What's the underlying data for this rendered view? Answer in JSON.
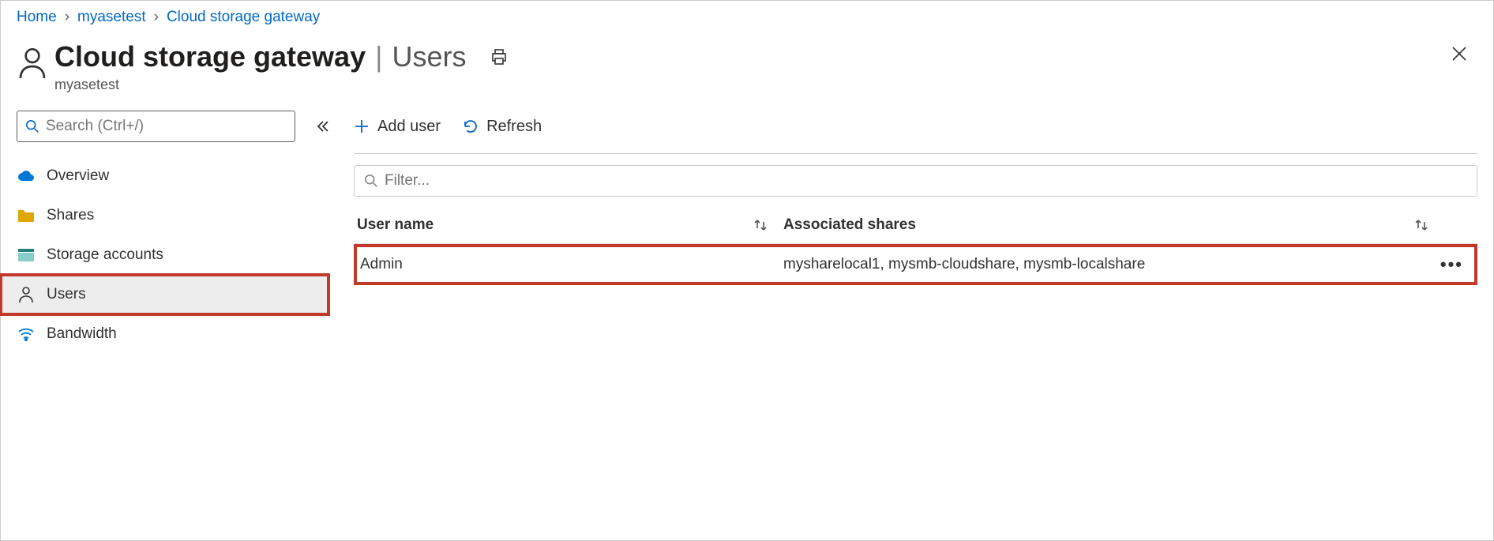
{
  "breadcrumb": {
    "items": [
      "Home",
      "myasetest",
      "Cloud storage gateway"
    ]
  },
  "header": {
    "title": "Cloud storage gateway",
    "section": "Users",
    "subtitle": "myasetest"
  },
  "sidebar": {
    "search_placeholder": "Search (Ctrl+/)",
    "items": [
      {
        "label": "Overview"
      },
      {
        "label": "Shares"
      },
      {
        "label": "Storage accounts"
      },
      {
        "label": "Users"
      },
      {
        "label": "Bandwidth"
      }
    ]
  },
  "toolbar": {
    "add_user": "Add user",
    "refresh": "Refresh"
  },
  "filter": {
    "placeholder": "Filter..."
  },
  "table": {
    "col_user": "User name",
    "col_shares": "Associated shares",
    "rows": [
      {
        "user": "Admin",
        "shares": "mysharelocal1, mysmb-cloudshare, mysmb-localshare"
      }
    ]
  }
}
